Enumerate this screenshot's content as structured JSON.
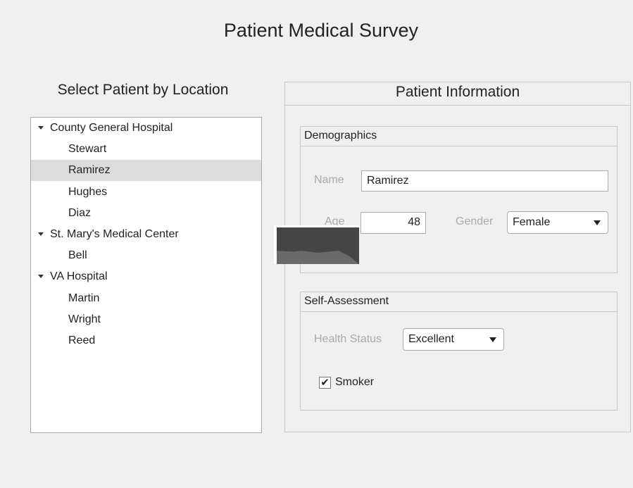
{
  "title": "Patient Medical Survey",
  "tree": {
    "title": "Select Patient by Location",
    "nodes": [
      {
        "label": "County General Hospital",
        "level": 0
      },
      {
        "label": "Stewart",
        "level": 1
      },
      {
        "label": "Ramirez",
        "level": 1,
        "selected": true
      },
      {
        "label": "Hughes",
        "level": 1
      },
      {
        "label": "Diaz",
        "level": 1
      },
      {
        "label": "St. Mary's Medical Center",
        "level": 0
      },
      {
        "label": "Bell",
        "level": 1
      },
      {
        "label": "VA Hospital",
        "level": 0
      },
      {
        "label": "Martin",
        "level": 1
      },
      {
        "label": "Wright",
        "level": 1
      },
      {
        "label": "Reed",
        "level": 1
      }
    ]
  },
  "panel": {
    "title": "Patient Information",
    "demographics": {
      "title": "Demographics",
      "name_label": "Name",
      "name_value": "Ramirez",
      "age_label": "Age",
      "age_value": "48",
      "gender_label": "Gender",
      "gender_value": "Female"
    },
    "self_assessment": {
      "title": "Self-Assessment",
      "health_label": "Health Status",
      "health_value": "Excellent",
      "smoker_label": "Smoker",
      "smoker_checked": true
    }
  }
}
